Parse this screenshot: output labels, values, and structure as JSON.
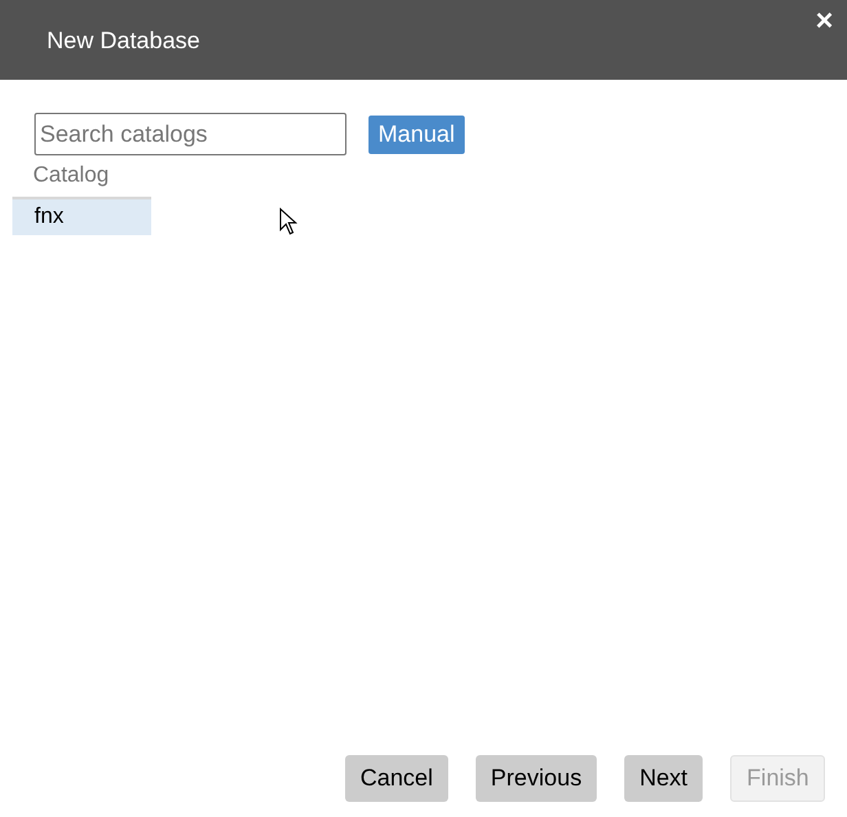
{
  "window": {
    "title": "New Database",
    "close": "×"
  },
  "search": {
    "placeholder": "Search catalogs"
  },
  "manual_button": "Manual",
  "catalog_label": "Catalog",
  "catalogs": [
    {
      "name": "fnx",
      "selected": true
    }
  ],
  "buttons": [
    {
      "label": "Cancel",
      "disabled": false
    },
    {
      "label": "Previous",
      "disabled": false
    },
    {
      "label": "Next",
      "disabled": false
    },
    {
      "label": "Finish",
      "disabled": true
    }
  ]
}
